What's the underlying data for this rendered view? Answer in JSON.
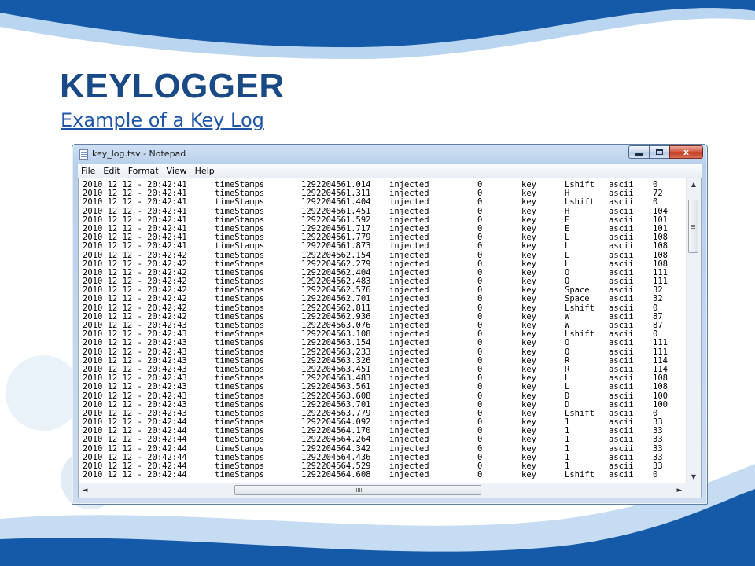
{
  "slide": {
    "title": "KEYLOGGER",
    "subtitle": "Example of a Key Log",
    "colors": {
      "title": "#1a4a86",
      "subtitle": "#1f56a8",
      "wave_dark": "#155aa8",
      "wave_light": "#7fb2e2"
    }
  },
  "window": {
    "title": "key_log.tsv - Notepad",
    "icon": "notepad-icon",
    "caption_buttons": {
      "minimize": "minimize-icon",
      "maximize": "maximize-icon",
      "close": "x"
    },
    "menu": [
      {
        "accel": "F",
        "rest": "ile"
      },
      {
        "accel": "E",
        "rest": "dit"
      },
      {
        "pre": "F",
        "accel": "o",
        "rest": "rmat"
      },
      {
        "accel": "V",
        "rest": "iew"
      },
      {
        "accel": "H",
        "rest": "elp"
      }
    ],
    "log_rows": [
      [
        "2010 12 12 - 20:42:41",
        "timeStamps",
        "1292204561.014",
        "injected",
        "0",
        "key",
        "Lshift",
        "ascii",
        "0"
      ],
      [
        "2010 12 12 - 20:42:41",
        "timeStamps",
        "1292204561.311",
        "injected",
        "0",
        "key",
        "H",
        "ascii",
        "72"
      ],
      [
        "2010 12 12 - 20:42:41",
        "timeStamps",
        "1292204561.404",
        "injected",
        "0",
        "key",
        "Lshift",
        "ascii",
        "0"
      ],
      [
        "2010 12 12 - 20:42:41",
        "timeStamps",
        "1292204561.451",
        "injected",
        "0",
        "key",
        "H",
        "ascii",
        "104"
      ],
      [
        "2010 12 12 - 20:42:41",
        "timeStamps",
        "1292204561.592",
        "injected",
        "0",
        "key",
        "E",
        "ascii",
        "101"
      ],
      [
        "2010 12 12 - 20:42:41",
        "timeStamps",
        "1292204561.717",
        "injected",
        "0",
        "key",
        "E",
        "ascii",
        "101"
      ],
      [
        "2010 12 12 - 20:42:41",
        "timeStamps",
        "1292204561.779",
        "injected",
        "0",
        "key",
        "L",
        "ascii",
        "108"
      ],
      [
        "2010 12 12 - 20:42:41",
        "timeStamps",
        "1292204561.873",
        "injected",
        "0",
        "key",
        "L",
        "ascii",
        "108"
      ],
      [
        "2010 12 12 - 20:42:42",
        "timeStamps",
        "1292204562.154",
        "injected",
        "0",
        "key",
        "L",
        "ascii",
        "108"
      ],
      [
        "2010 12 12 - 20:42:42",
        "timeStamps",
        "1292204562.279",
        "injected",
        "0",
        "key",
        "L",
        "ascii",
        "108"
      ],
      [
        "2010 12 12 - 20:42:42",
        "timeStamps",
        "1292204562.404",
        "injected",
        "0",
        "key",
        "O",
        "ascii",
        "111"
      ],
      [
        "2010 12 12 - 20:42:42",
        "timeStamps",
        "1292204562.483",
        "injected",
        "0",
        "key",
        "O",
        "ascii",
        "111"
      ],
      [
        "2010 12 12 - 20:42:42",
        "timeStamps",
        "1292204562.576",
        "injected",
        "0",
        "key",
        "Space",
        "ascii",
        "32"
      ],
      [
        "2010 12 12 - 20:42:42",
        "timeStamps",
        "1292204562.701",
        "injected",
        "0",
        "key",
        "Space",
        "ascii",
        "32"
      ],
      [
        "2010 12 12 - 20:42:42",
        "timeStamps",
        "1292204562.811",
        "injected",
        "0",
        "key",
        "Lshift",
        "ascii",
        "0"
      ],
      [
        "2010 12 12 - 20:42:42",
        "timeStamps",
        "1292204562.936",
        "injected",
        "0",
        "key",
        "W",
        "ascii",
        "87"
      ],
      [
        "2010 12 12 - 20:42:43",
        "timeStamps",
        "1292204563.076",
        "injected",
        "0",
        "key",
        "W",
        "ascii",
        "87"
      ],
      [
        "2010 12 12 - 20:42:43",
        "timeStamps",
        "1292204563.108",
        "injected",
        "0",
        "key",
        "Lshift",
        "ascii",
        "0"
      ],
      [
        "2010 12 12 - 20:42:43",
        "timeStamps",
        "1292204563.154",
        "injected",
        "0",
        "key",
        "O",
        "ascii",
        "111"
      ],
      [
        "2010 12 12 - 20:42:43",
        "timeStamps",
        "1292204563.233",
        "injected",
        "0",
        "key",
        "O",
        "ascii",
        "111"
      ],
      [
        "2010 12 12 - 20:42:43",
        "timeStamps",
        "1292204563.326",
        "injected",
        "0",
        "key",
        "R",
        "ascii",
        "114"
      ],
      [
        "2010 12 12 - 20:42:43",
        "timeStamps",
        "1292204563.451",
        "injected",
        "0",
        "key",
        "R",
        "ascii",
        "114"
      ],
      [
        "2010 12 12 - 20:42:43",
        "timeStamps",
        "1292204563.483",
        "injected",
        "0",
        "key",
        "L",
        "ascii",
        "108"
      ],
      [
        "2010 12 12 - 20:42:43",
        "timeStamps",
        "1292204563.561",
        "injected",
        "0",
        "key",
        "L",
        "ascii",
        "108"
      ],
      [
        "2010 12 12 - 20:42:43",
        "timeStamps",
        "1292204563.608",
        "injected",
        "0",
        "key",
        "D",
        "ascii",
        "100"
      ],
      [
        "2010 12 12 - 20:42:43",
        "timeStamps",
        "1292204563.701",
        "injected",
        "0",
        "key",
        "D",
        "ascii",
        "100"
      ],
      [
        "2010 12 12 - 20:42:43",
        "timeStamps",
        "1292204563.779",
        "injected",
        "0",
        "key",
        "Lshift",
        "ascii",
        "0"
      ],
      [
        "2010 12 12 - 20:42:44",
        "timeStamps",
        "1292204564.092",
        "injected",
        "0",
        "key",
        "1",
        "ascii",
        "33"
      ],
      [
        "2010 12 12 - 20:42:44",
        "timeStamps",
        "1292204564.170",
        "injected",
        "0",
        "key",
        "1",
        "ascii",
        "33"
      ],
      [
        "2010 12 12 - 20:42:44",
        "timeStamps",
        "1292204564.264",
        "injected",
        "0",
        "key",
        "1",
        "ascii",
        "33"
      ],
      [
        "2010 12 12 - 20:42:44",
        "timeStamps",
        "1292204564.342",
        "injected",
        "0",
        "key",
        "1",
        "ascii",
        "33"
      ],
      [
        "2010 12 12 - 20:42:44",
        "timeStamps",
        "1292204564.436",
        "injected",
        "0",
        "key",
        "1",
        "ascii",
        "33"
      ],
      [
        "2010 12 12 - 20:42:44",
        "timeStamps",
        "1292204564.529",
        "injected",
        "0",
        "key",
        "1",
        "ascii",
        "33"
      ],
      [
        "2010 12 12 - 20:42:44",
        "timeStamps",
        "1292204564.608",
        "injected",
        "0",
        "key",
        "Lshift",
        "ascii",
        "0"
      ]
    ],
    "scrollbar": {
      "up_icon": "▲",
      "down_icon": "▼",
      "left_icon": "◄",
      "right_icon": "►"
    }
  }
}
